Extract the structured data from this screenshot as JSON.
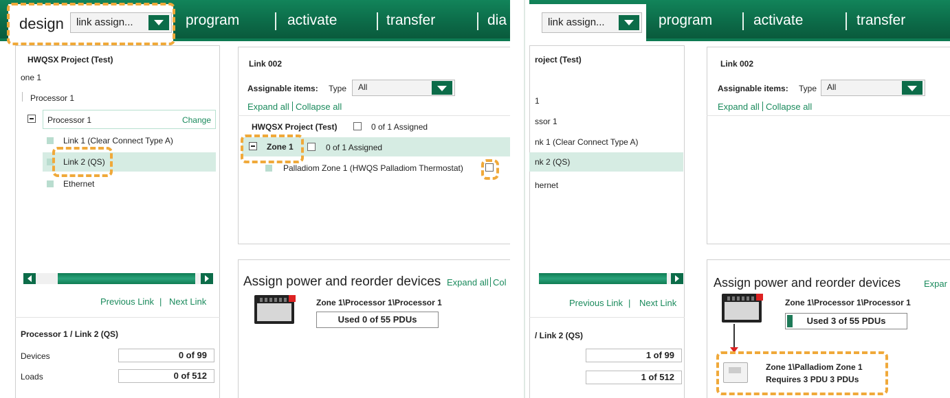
{
  "nav": {
    "design": "design",
    "link_assign": "link assign...",
    "program": "program",
    "activate": "activate",
    "transfer": "transfer",
    "dia": "dia"
  },
  "tree": {
    "project": "HWQSX Project (Test)",
    "project_cropped": "roject (Test)",
    "zone1": "one 1",
    "processor_parent": "Processor 1",
    "processor_parent_cropped": "1",
    "processor_selected": "Processor 1",
    "processor_selected_cropped": "ssor 1",
    "change": "Change",
    "link1": "Link 1 (Clear Connect Type A)",
    "link1_cropped": "nk 1 (Clear Connect Type A)",
    "link2": "Link 2 (QS)",
    "link2_cropped": "nk 2 (QS)",
    "ethernet": "Ethernet",
    "ethernet_cropped": "hernet",
    "previous_link": "Previous Link",
    "separator": "|",
    "next_link": "Next Link"
  },
  "summary": {
    "title": "Processor 1 / Link 2 (QS)",
    "title_cropped": "/ Link 2 (QS)",
    "devices_label": "Devices",
    "loads_label": "Loads",
    "left": {
      "devices": "0 of 99",
      "loads": "0 of 512"
    },
    "right": {
      "devices": "1 of 99",
      "loads": "1 of 512"
    }
  },
  "assign": {
    "link_title": "Link 002",
    "assignable_label": "Assignable items:",
    "type_label": "Type",
    "type_value": "All",
    "expand_all": "Expand all",
    "collapse_all": "Collapse all",
    "project_row": "HWQSX Project (Test)",
    "project_assigned": "0 of 1 Assigned",
    "zone_row": "Zone 1",
    "zone_assigned": "0 of 1 Assigned",
    "palladiom": "Palladiom Zone 1 (HWQS Palladiom Thermostat)"
  },
  "power": {
    "title": "Assign power and reorder devices",
    "expand_all": "Expand all",
    "col_cropped": "Col",
    "expar_cropped": "Expar",
    "processor_path": "Zone 1\\Processor 1\\Processor 1",
    "left_used": "Used 0 of 55 PDUs",
    "right_used": "Used 3 of 55 PDUs",
    "device_path": "Zone 1\\Palladiom Zone 1",
    "requires": "Requires 3 PDU 3 PDUs"
  },
  "colors": {
    "brand_green": "#0c6c49",
    "highlight": "#f0a93a",
    "selection": "#d6ece3"
  }
}
